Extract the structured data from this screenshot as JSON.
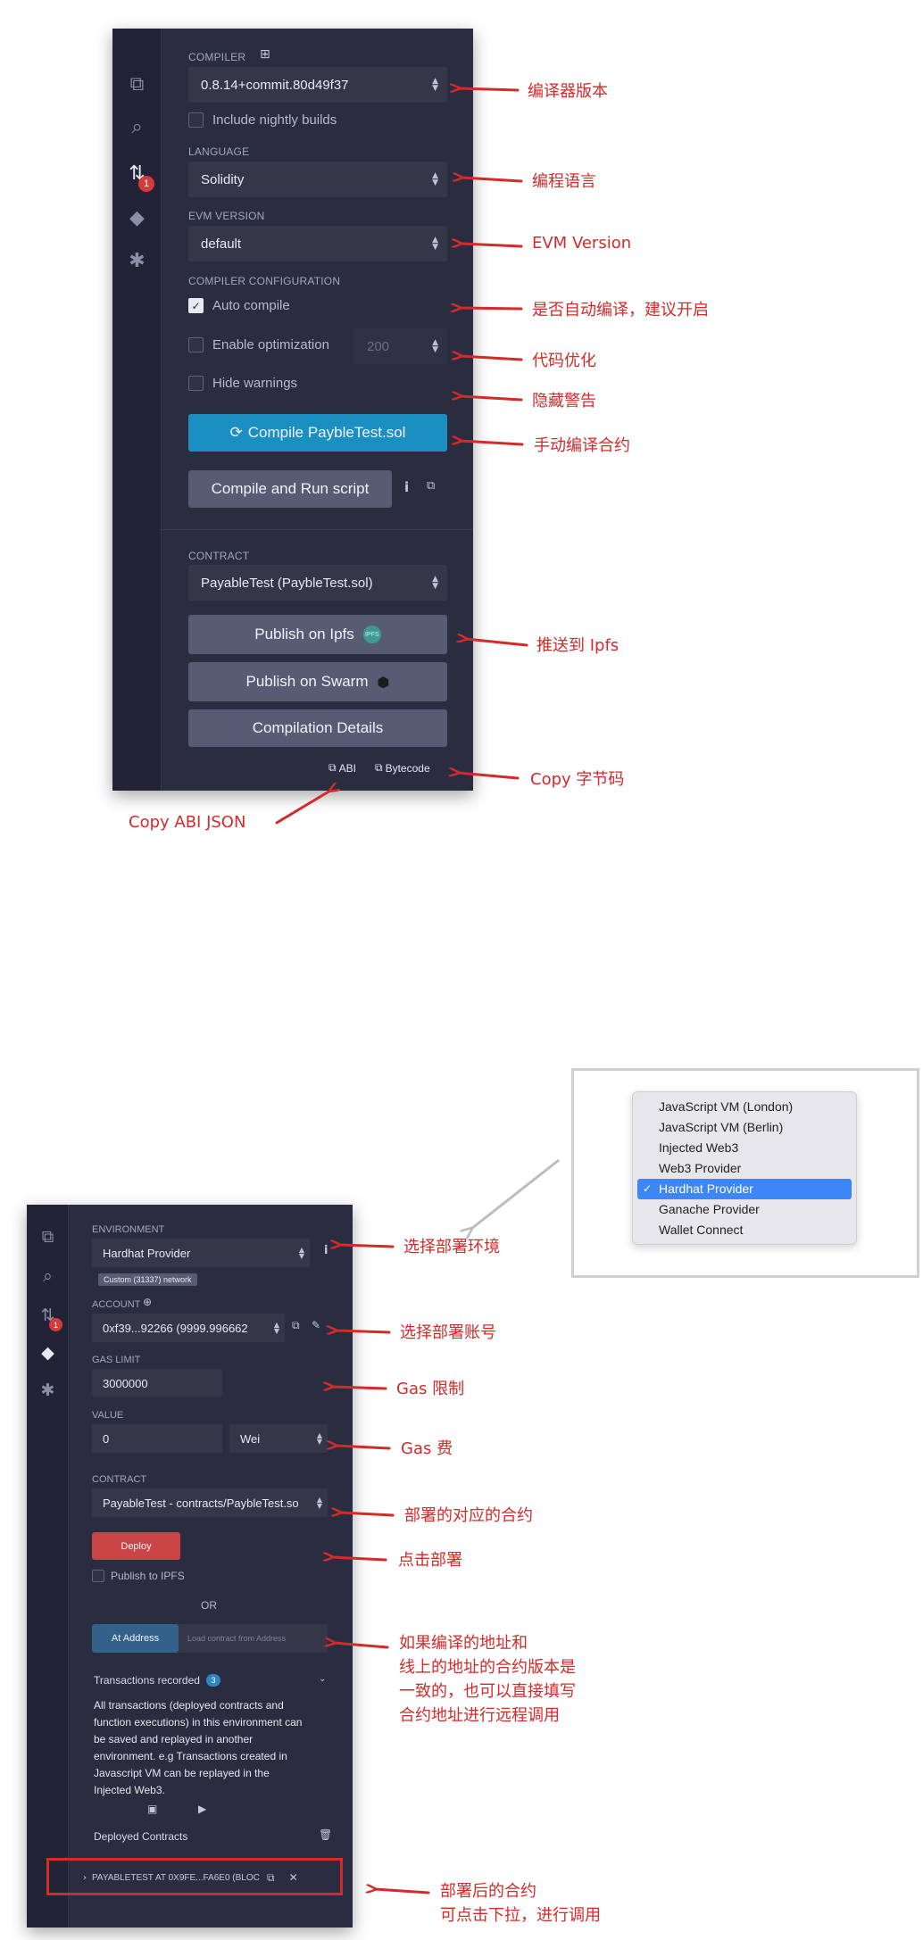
{
  "compiler_panel": {
    "icon_bar": {
      "icons": [
        "file-explorer-icon",
        "search-icon",
        "solidity-compiler-icon",
        "deploy-run-icon",
        "debugger-icon"
      ],
      "badge_count": "1"
    },
    "compiler_label": "COMPILER",
    "compiler_version": "0.8.14+commit.80d49f37",
    "include_nightly_label": "Include nightly builds",
    "language_label": "LANGUAGE",
    "language_value": "Solidity",
    "evm_version_label": "EVM VERSION",
    "evm_version_value": "default",
    "compiler_config_label": "COMPILER CONFIGURATION",
    "auto_compile_label": "Auto compile",
    "auto_compile_checked": true,
    "enable_optimization_label": "Enable optimization",
    "optimization_runs": "200",
    "hide_warnings_label": "Hide warnings",
    "compile_button": "Compile PaybleTest.sol",
    "compile_run_button": "Compile and Run script",
    "contract_label": "CONTRACT",
    "contract_value": "PayableTest (PaybleTest.sol)",
    "publish_ipfs_button": "Publish on Ipfs",
    "ipfs_logo_text": "IPFS",
    "publish_swarm_button": "Publish on Swarm",
    "compilation_details_button": "Compilation Details",
    "copy_abi_label": "ABI",
    "copy_bytecode_label": "Bytecode"
  },
  "annotations_top": {
    "compiler_version": "编译器版本",
    "language": "编程语言",
    "evm_version": "EVM Version",
    "auto_compile": "是否自动编译，建议开启",
    "optimization": "代码优化",
    "hide_warnings": "隐藏警告",
    "manual_compile": "手动编译合约",
    "publish_ipfs": "推送到 Ipfs",
    "copy_bytecode": "Copy 字节码",
    "copy_abi": "Copy ABI JSON"
  },
  "environment_menu": {
    "items": [
      "JavaScript VM (London)",
      "JavaScript VM (Berlin)",
      "Injected Web3",
      "Web3 Provider",
      "Hardhat Provider",
      "Ganache Provider",
      "Wallet Connect"
    ],
    "selected": "Hardhat Provider"
  },
  "deploy_panel": {
    "icon_bar": {
      "icons": [
        "file-explorer-icon",
        "search-icon",
        "solidity-compiler-icon",
        "deploy-run-icon",
        "debugger-icon"
      ],
      "badge_count": "1"
    },
    "environment_label": "ENVIRONMENT",
    "environment_value": "Hardhat Provider",
    "network_tag": "Custom (31337) network",
    "account_label": "ACCOUNT",
    "account_value": "0xf39...92266 (9999.996662",
    "gas_limit_label": "GAS LIMIT",
    "gas_limit_value": "3000000",
    "value_label": "VALUE",
    "value_amount": "0",
    "value_unit": "Wei",
    "contract_label": "CONTRACT",
    "contract_value": "PayableTest - contracts/PaybleTest.so",
    "deploy_button": "Deploy",
    "publish_ipfs_label": "Publish to IPFS",
    "or_label": "OR",
    "at_address_button": "At Address",
    "load_address_placeholder": "Load contract from Address",
    "transactions_recorded_label": "Transactions recorded",
    "transactions_count": "3",
    "transactions_description": "All transactions (deployed contracts and function executions) in this environment can be saved and replayed in another environment. e.g Transactions created in Javascript VM can be replayed in the Injected Web3.",
    "deployed_contracts_label": "Deployed Contracts",
    "deployed_contract_item": "PAYABLETEST AT 0X9FE...FA6E0 (BLOC"
  },
  "annotations_bottom": {
    "environment": "选择部署环境",
    "account": "选择部署账号",
    "gas_limit": "Gas 限制",
    "gas_fee": "Gas 费",
    "contract": "部署的对应的合约",
    "deploy": "点击部署",
    "at_address": "如果编译的地址和\n线上的地址的合约版本是\n一致的，也可以直接填写\n合约地址进行远程调用",
    "deployed": "部署后的合约\n可点击下拉，进行调用"
  },
  "colors": {
    "panel_bg": "#2a2c3f",
    "iconbar_bg": "#222336",
    "compile_blue": "#1b8fc2",
    "button_grey": "#575b73",
    "deploy_red": "#c94545",
    "annotation_red": "#d32a2a",
    "menu_selected": "#3d86f7"
  }
}
